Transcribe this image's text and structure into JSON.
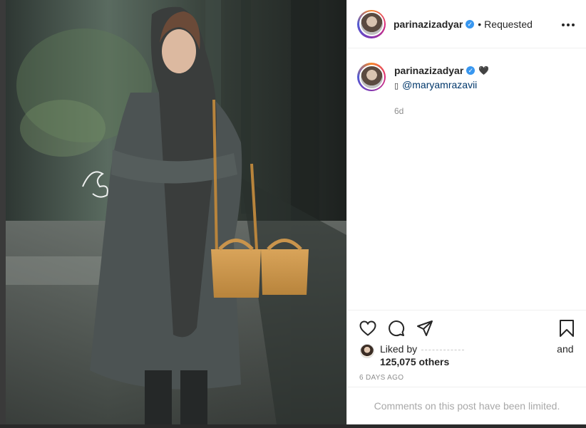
{
  "post": {
    "author": {
      "username": "parinazizadyar",
      "verified_glyph": "✓",
      "follow_separator": "•",
      "follow_status": "Requested"
    },
    "more_icon": "more-horizontal-icon",
    "caption": {
      "username": "parinazizadyar",
      "emoji": "🖤",
      "mention_prefix": "▯",
      "mention": "@maryamrazavii",
      "time_ago": "6d"
    },
    "actions": {
      "like_icon": "heart-outline-icon",
      "comment_icon": "comment-icon",
      "share_icon": "paper-plane-icon",
      "save_icon": "bookmark-icon"
    },
    "likes": {
      "prefix": "Liked by",
      "and_text": "and",
      "others": "125,075 others"
    },
    "date": "6 DAYS AGO",
    "comments_notice": "Comments on this post have been limited."
  },
  "colors": {
    "link": "#00376b",
    "verified": "#3897f0",
    "muted": "#8e8e8e",
    "border": "#efefef"
  }
}
